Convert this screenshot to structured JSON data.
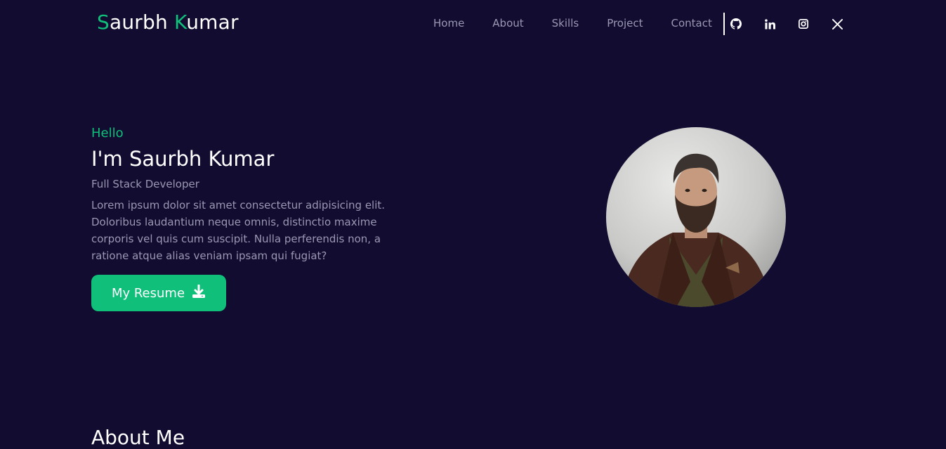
{
  "brand": {
    "first_initial": "S",
    "first_rest": "aurbh",
    "last_initial": "K",
    "last_rest": "umar",
    "accent_color": "#0fbf7a"
  },
  "nav": {
    "items": [
      {
        "label": "Home"
      },
      {
        "label": "About"
      },
      {
        "label": "Skills"
      },
      {
        "label": "Project"
      },
      {
        "label": "Contact"
      }
    ],
    "socials": [
      {
        "icon": "github-icon"
      },
      {
        "icon": "linkedin-icon"
      },
      {
        "icon": "instagram-icon"
      },
      {
        "icon": "x-twitter-icon"
      }
    ]
  },
  "hero": {
    "greeting": "Hello",
    "headline": "I'm Saurbh Kumar",
    "role": "Full Stack Developer",
    "bio": "Lorem ipsum dolor sit amet consectetur adipisicing elit. Doloribus laudantium neque omnis, distinctio maxime corporis vel quis cum suscipit. Nulla perferendis non, a ratione atque alias veniam ipsam qui fugiat?",
    "resume_label": "My Resume",
    "resume_icon": "download-icon",
    "avatar_icon": "profile-photo"
  },
  "about": {
    "heading": "About Me"
  },
  "colors": {
    "background": "#110c30",
    "accent": "#0fbf7a",
    "muted_text": "#9b98b3"
  }
}
